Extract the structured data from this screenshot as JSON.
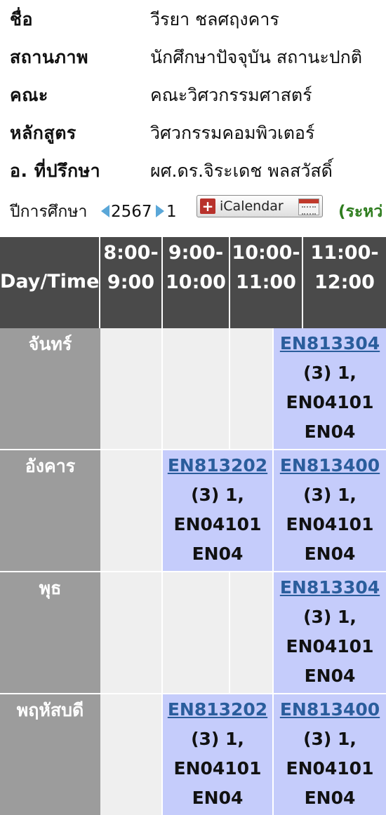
{
  "student": {
    "name_label": "ชื่อ",
    "name_value": "วีรยา ชลศฤงคาร",
    "status_label": "สถานภาพ",
    "status_value": "นักศึกษาปัจจุบัน สถานะปกติ",
    "faculty_label": "คณะ",
    "faculty_value": "คณะวิศวกรรมศาสตร์",
    "program_label": "หลักสูตร",
    "program_value": "วิศวกรรมคอมพิวเตอร์",
    "advisor_label": "อ. ที่ปรึกษา",
    "advisor_value": "ผศ.ดร.จิระเดช พลสวัสดิ์"
  },
  "term": {
    "year_label": "ปีการศึกษา",
    "year_value": "2567",
    "semester_value": "1",
    "ical_label": "iCalendar",
    "ical_plus": "+",
    "status_note": "(ระหว่"
  },
  "timetable": {
    "header_day": "Day/Time",
    "slots": [
      {
        "l1": "8:00-",
        "l2": "9:00"
      },
      {
        "l1": "9:00-",
        "l2": "10:00"
      },
      {
        "l1": "10:00-",
        "l2": "11:00"
      },
      {
        "l1": "11:00-",
        "l2": "12:00"
      }
    ],
    "days": [
      {
        "name": "จันทร์",
        "c2": {
          "code": "",
          "l2": "",
          "l3": "",
          "l4": ""
        },
        "c3": {
          "code": "EN813304",
          "l2": "(3) 1,",
          "l3": "EN04101",
          "l4": "EN04"
        }
      },
      {
        "name": "อังคาร",
        "c2": {
          "code": "EN813202",
          "l2": "(3) 1,",
          "l3": "EN04101",
          "l4": "EN04"
        },
        "c3": {
          "code": "EN813400",
          "l2": "(3) 1,",
          "l3": "EN04101",
          "l4": "EN04"
        }
      },
      {
        "name": "พุธ",
        "c2": {
          "code": "",
          "l2": "",
          "l3": "",
          "l4": ""
        },
        "c3": {
          "code": "EN813304",
          "l2": "(3) 1,",
          "l3": "EN04101",
          "l4": "EN04"
        }
      },
      {
        "name": "พฤหัสบดี",
        "c2": {
          "code": "EN813202",
          "l2": "(3) 1,",
          "l3": "EN04101",
          "l4": "EN04"
        },
        "c3": {
          "code": "EN813400",
          "l2": "(3) 1,",
          "l3": "EN04101",
          "l4": "EN04"
        }
      }
    ]
  },
  "colors": {
    "header_bg": "#4a4a4a",
    "day_bg": "#9c9c9c",
    "course_bg": "#c5ccfb",
    "course_link": "#2a5d9c",
    "status_note": "#2f7d1f"
  }
}
